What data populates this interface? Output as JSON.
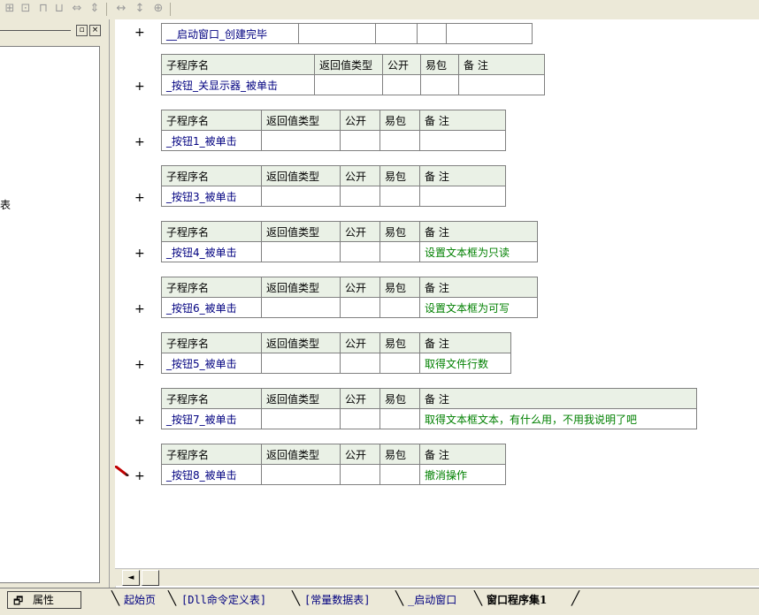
{
  "toolbar": {
    "icons": [
      "split-h-icon",
      "split-v-icon",
      "align-top-icon",
      "align-bottom-icon",
      "width-icon",
      "height-icon",
      "same-width-icon",
      "same-height-icon",
      "center-icon"
    ]
  },
  "left_panel": {
    "minimize_glyph": "▫",
    "close_glyph": "×",
    "truncated_text": "表"
  },
  "header_row": {
    "name_col": "子程序名",
    "return_col": "返回值类型",
    "public_col": "公开",
    "easy_col": "易包",
    "note_col": "备 注"
  },
  "first_row": {
    "name": "__启动窗口_创建完毕"
  },
  "subroutines": [
    {
      "name": "_按钮_关显示器_被单击",
      "note": ""
    },
    {
      "name": "_按钮1_被单击",
      "note": ""
    },
    {
      "name": "_按钮3_被单击",
      "note": ""
    },
    {
      "name": "_按钮4_被单击",
      "note": "设置文本框为只读"
    },
    {
      "name": "_按钮6_被单击",
      "note": "设置文本框为可写"
    },
    {
      "name": "_按钮5_被单击",
      "note": "取得文件行数"
    },
    {
      "name": "_按钮7_被单击",
      "note": "取得文本框文本，有什么用，不用我说明了吧"
    },
    {
      "name": "_按钮8_被单击",
      "note": "撤消操作"
    }
  ],
  "plus_glyph": "+",
  "scroll_left_glyph": "◄",
  "bottom": {
    "properties_label": "属性",
    "tabs": [
      "起始页",
      "[Dll命令定义表]",
      "[常量数据表]",
      "_启动窗口",
      "窗口程序集1"
    ],
    "active_tab": "窗口程序集1"
  },
  "colors": {
    "header_bg": "#eaf1e6",
    "note_text": "#008000",
    "name_text": "#000080",
    "chrome_bg": "#ece9d8"
  }
}
